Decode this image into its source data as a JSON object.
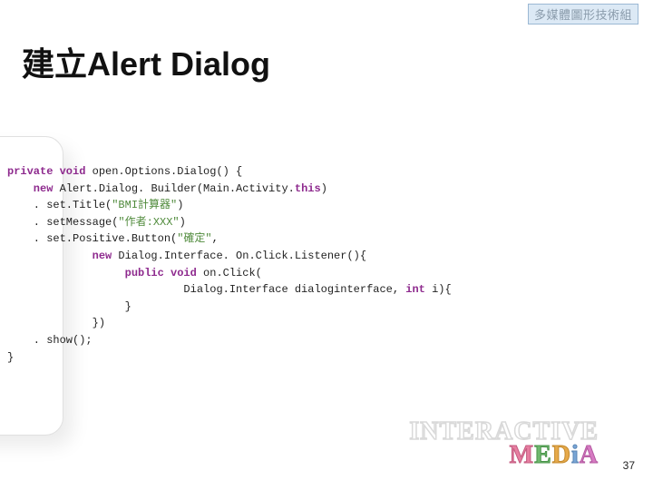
{
  "badge": "多媒體圖形技術組",
  "title": "建立Alert Dialog",
  "code": {
    "l1a": "private void",
    "l1b": " open.Options.Dialog() {",
    "l2a": "    new",
    "l2b": " Alert.Dialog. Builder(Main.Activity.",
    "l2c": "this",
    "l2d": ")",
    "l3a": "    . set.Title(",
    "l3b": "\"BMI計算器\"",
    "l3c": ")",
    "l4a": "    . setMessage(",
    "l4b": "\"作者:XXX\"",
    "l4c": ")",
    "l5a": "    . set.Positive.Button(",
    "l5b": "\"確定\"",
    "l5c": ",",
    "l6a": "             new",
    "l6b": " Dialog.Interface. On.Click.Listener(){",
    "l7a": "                  public void",
    "l7b": " on.Click(",
    "l8a": "                           Dialog.Interface dialoginterface, ",
    "l8b": "int",
    "l8c": " i){",
    "l9": "                  }",
    "l10": "             })",
    "l11": "    . show();",
    "l12": "}"
  },
  "brand": {
    "line1": "INTERACTIVE",
    "m1": "M",
    "m2": "E",
    "m3": "D",
    "m4": "i",
    "m5": "A"
  },
  "page": "37"
}
